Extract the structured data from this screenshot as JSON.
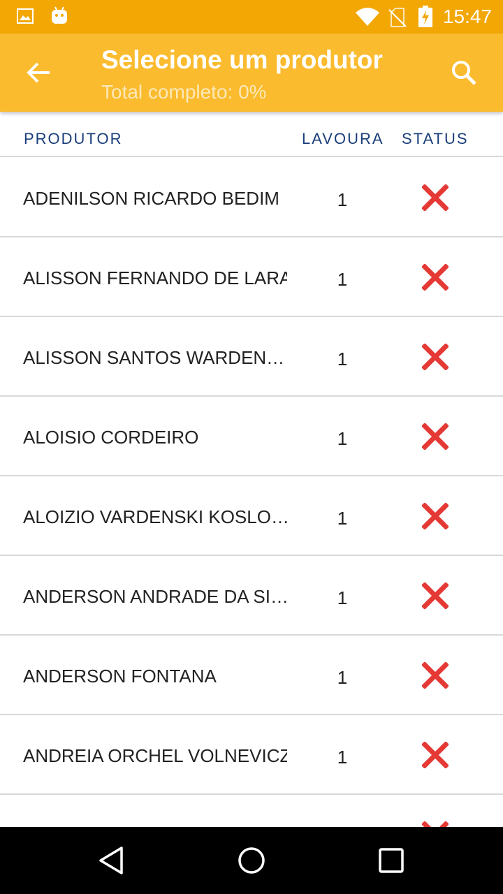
{
  "status_bar": {
    "time": "15:47",
    "icons": [
      "image-icon",
      "android-icon",
      "wifi-icon",
      "no-sim-icon",
      "battery-charging-icon"
    ]
  },
  "app_bar": {
    "title": "Selecione um produtor",
    "subtitle": "Total completo: 0%",
    "back_icon": "arrow-back-icon",
    "search_icon": "search-icon"
  },
  "table": {
    "headers": {
      "produtor": "PRODUTOR",
      "lavoura": "LAVOURA",
      "status": "STATUS"
    },
    "rows": [
      {
        "name": "ADENILSON RICARDO BEDIM",
        "lavoura": "1",
        "status": "incomplete"
      },
      {
        "name": "ALISSON FERNANDO DE LARA",
        "lavoura": "1",
        "status": "incomplete"
      },
      {
        "name": "ALISSON SANTOS WARDEN…",
        "lavoura": "1",
        "status": "incomplete"
      },
      {
        "name": "ALOISIO CORDEIRO",
        "lavoura": "1",
        "status": "incomplete"
      },
      {
        "name": "ALOIZIO VARDENSKI KOSLO…",
        "lavoura": "1",
        "status": "incomplete"
      },
      {
        "name": "ANDERSON ANDRADE DA SI…",
        "lavoura": "1",
        "status": "incomplete"
      },
      {
        "name": "ANDERSON FONTANA",
        "lavoura": "1",
        "status": "incomplete"
      },
      {
        "name": "ANDREIA ORCHEL VOLNEVICZ",
        "lavoura": "1",
        "status": "incomplete"
      }
    ]
  },
  "colors": {
    "status_bar": "#F2A705",
    "app_bar": "#FBBB2E",
    "header_text": "#1A3E7A",
    "status_x": "#E53935"
  },
  "nav_bar": {
    "icons": [
      "back-triangle-icon",
      "home-circle-icon",
      "recents-square-icon"
    ]
  }
}
